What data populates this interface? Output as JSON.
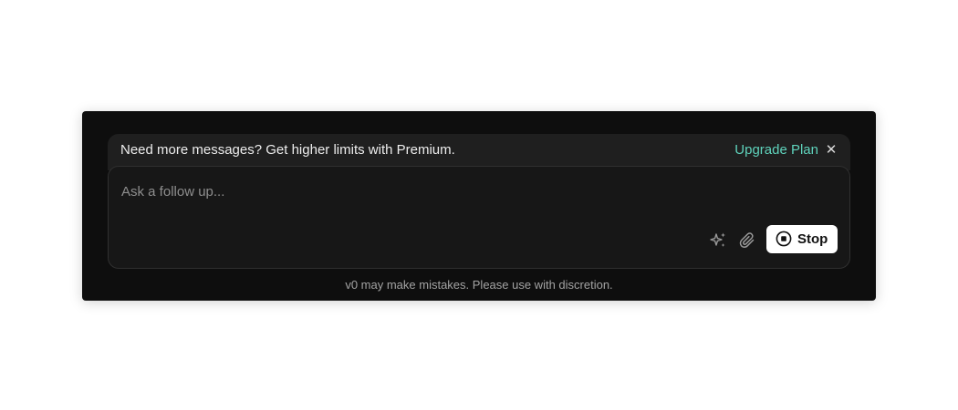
{
  "banner": {
    "message": "Need more messages? Get higher limits with Premium.",
    "upgrade_label": "Upgrade Plan",
    "close_glyph": "✕",
    "accent_color": "#5fd3bc"
  },
  "composer": {
    "placeholder": "Ask a follow up...",
    "value": "",
    "icons": [
      "sparkles-icon",
      "paperclip-icon",
      "stop-circle-icon"
    ],
    "stop_label": "Stop"
  },
  "footer": {
    "disclaimer": "v0 may make mistakes. Please use with discretion."
  }
}
